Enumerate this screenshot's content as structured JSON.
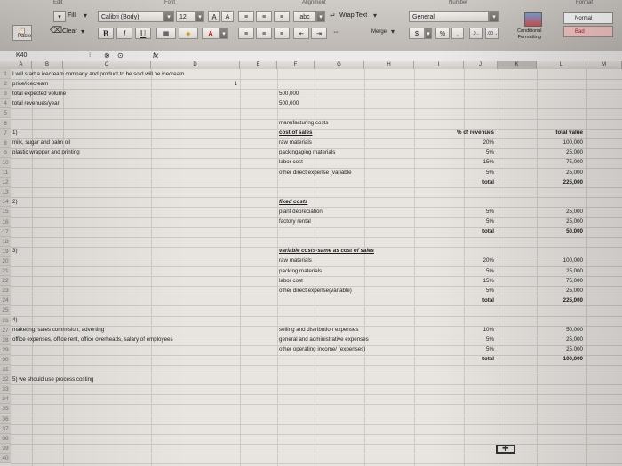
{
  "ribbon": {
    "edit_label": "Edit",
    "font_group_label": "Font",
    "alignment_group_label": "Alignment",
    "number_group_label": "Number",
    "format_group_label": "Format",
    "fill_label": "Fill",
    "font_name": "Calibri (Body)",
    "font_size": "12",
    "grow_font": "A",
    "shrink_font": "A",
    "bold": "B",
    "italic": "I",
    "underline": "U",
    "font_color_glyph": "A",
    "abc_label": "abc",
    "wrap_text_label": "Wrap Text",
    "merge_label": "Merge",
    "number_format": "General",
    "percent_glyph": "%",
    "comma_glyph": ",",
    "conditional_formatting_label": "Conditional\nFormatting",
    "style_normal": "Normal",
    "style_bad": "Bad",
    "paste_label": "Paste",
    "clear_label": "Clear"
  },
  "formula_bar": {
    "name_box": "K40",
    "fx": "fx",
    "value": ""
  },
  "columns": [
    "A",
    "B",
    "C",
    "D",
    "E",
    "F",
    "G",
    "H",
    "I",
    "J",
    "K",
    "L",
    "M"
  ],
  "rows": [
    "1",
    "2",
    "3",
    "4",
    "5",
    "6",
    "7",
    "8",
    "9",
    "10",
    "11",
    "12",
    "13",
    "14",
    "15",
    "16",
    "17",
    "18",
    "19",
    "20",
    "21",
    "22",
    "23",
    "24",
    "25",
    "26",
    "27",
    "28",
    "29",
    "30",
    "31",
    "32",
    "33",
    "34",
    "35",
    "36",
    "37",
    "38",
    "39",
    "40"
  ],
  "cells": {
    "a1": "I will start a icecream company and product to be sold will be icecream",
    "a2": "price/icecream",
    "d2": "1",
    "a3": "total expected volume",
    "f3": "500,000",
    "a4": "total revenues/year",
    "f4": "500,000",
    "f6": "manufacturing costs",
    "a7": "1)",
    "f7": "cost of sales",
    "j7": "% of revenues",
    "l7": "total value",
    "a8": "milk, sugar and palm oil",
    "f8": "raw materials",
    "j8": "20%",
    "l8": "100,000",
    "a9": "plastic wrapper and printing",
    "f9": "packingaging materials",
    "j9": "5%",
    "l9": "25,000",
    "f10": "labor cost",
    "j10": "15%",
    "l10": "75,000",
    "f11": "other direct expense (variable",
    "j11": "5%",
    "l11": "25,000",
    "j12": "total",
    "l12": "225,000",
    "a14": "2)",
    "f14": "fixed costs",
    "f15": "plant depreciation",
    "j15": "5%",
    "l15": "25,000",
    "f16": "factory rental",
    "j16": "5%",
    "l16": "25,000",
    "j17": "total",
    "l17": "50,000",
    "a19": "3)",
    "f19": "variable costs-same as cost of sales",
    "f20": "raw materials",
    "j20": "20%",
    "l20": "100,000",
    "f21": "packing materials",
    "j21": "5%",
    "l21": "25,000",
    "f22": "labor cost",
    "j22": "15%",
    "l22": "75,000",
    "f23": "other direct expense(variable)",
    "j23": "5%",
    "l23": "25,000",
    "j24": "total",
    "l24": "225,000",
    "a26": "4)",
    "a27": "maketing, sales commision, adverting",
    "f27": "selling and distribution expenses",
    "j27": "10%",
    "l27": "50,000",
    "a28": "office expenses, office rent, office overheads, salary of employees",
    "f28": "general and administrative expenses",
    "j28": "5%",
    "l28": "25,000",
    "f29": "other operating income/ (expenses)",
    "j29": "5%",
    "l29": "25,000",
    "j30": "total",
    "l30": "100,000",
    "a32": "5) we should use process costing"
  }
}
